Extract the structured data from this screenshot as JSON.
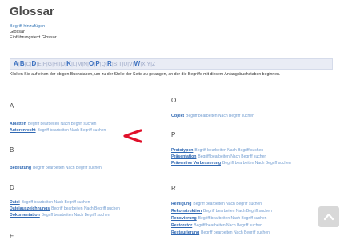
{
  "page": {
    "title": "Glossar",
    "add_link": "Begriff hinzufügen",
    "meta_line1": "Glossar",
    "meta_line2": "Einführungstext Glossar",
    "hint": "Klicken Sie auf einen der obigen Buchstaben, um zu der Stelle der Seite zu gelangen, an der die Begriffe mit diesem Anfangsbuchstaben beginnen."
  },
  "alphabet": [
    {
      "l": "A",
      "on": true
    },
    {
      "l": "B",
      "on": true
    },
    {
      "l": "C",
      "on": false
    },
    {
      "l": "D",
      "on": true
    },
    {
      "l": "E",
      "on": false
    },
    {
      "l": "F",
      "on": false
    },
    {
      "l": "G",
      "on": false
    },
    {
      "l": "H",
      "on": false
    },
    {
      "l": "I",
      "on": false
    },
    {
      "l": "J",
      "on": false
    },
    {
      "l": "K",
      "on": true
    },
    {
      "l": "L",
      "on": false
    },
    {
      "l": "M",
      "on": false
    },
    {
      "l": "N",
      "on": false
    },
    {
      "l": "O",
      "on": true
    },
    {
      "l": "P",
      "on": true
    },
    {
      "l": "Q",
      "on": false
    },
    {
      "l": "R",
      "on": true
    },
    {
      "l": "S",
      "on": false
    },
    {
      "l": "T",
      "on": false
    },
    {
      "l": "U",
      "on": false
    },
    {
      "l": "V",
      "on": false
    },
    {
      "l": "W",
      "on": true
    },
    {
      "l": "X",
      "on": false
    },
    {
      "l": "Y",
      "on": false
    },
    {
      "l": "Z",
      "on": false
    }
  ],
  "entry_links": "Begriff bearbeiten  Nach Begriff suchen",
  "left": {
    "A": {
      "letter": "A",
      "items": [
        "Ablatten",
        "Autorenrecht"
      ]
    },
    "B": {
      "letter": "B",
      "items": [
        "Bedeutung"
      ]
    },
    "D": {
      "letter": "D",
      "items": [
        "Datei",
        "Dateiauszeichnungs",
        "Dokumentation"
      ]
    },
    "E": {
      "letter": "E"
    }
  },
  "right": {
    "O": {
      "letter": "O",
      "items": [
        "Objekt"
      ]
    },
    "P": {
      "letter": "P",
      "items": [
        "Prototypen",
        "Präsentation",
        "Präventive Verbesserung"
      ]
    },
    "R": {
      "letter": "R",
      "items": [
        "Reinigung",
        "Rekonstruktion",
        "Renovierung",
        "Restorator",
        "Restaurierung"
      ]
    }
  },
  "colors": {
    "link": "#2f68b3",
    "annotation_arrow": "#e0102a"
  }
}
